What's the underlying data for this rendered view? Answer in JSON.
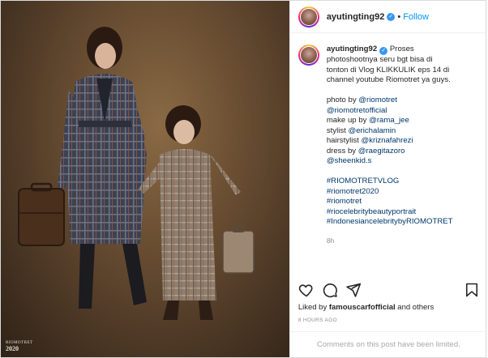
{
  "header": {
    "username": "ayutingting92",
    "separator": "•",
    "follow_label": "Follow",
    "verified_glyph": "✓"
  },
  "caption": {
    "username": "ayutingting92",
    "lines": [
      "Proses",
      "photoshootnya seru bgt bisa di",
      "tonton di Vlog KLIKKULIK eps 14 di",
      "channel youtube Riomotret ya guys."
    ],
    "credits": [
      {
        "prefix": "photo by ",
        "mention": "@riomotret"
      },
      {
        "prefix": "",
        "mention": "@riomotretofficial"
      },
      {
        "prefix": "make up by ",
        "mention": "@rama_jee"
      },
      {
        "prefix": "stylist ",
        "mention": "@erichalamin"
      },
      {
        "prefix": "hairstylist ",
        "mention": "@kriznafahrezi"
      },
      {
        "prefix": "dress by ",
        "mention": "@raegitazoro"
      },
      {
        "prefix": "",
        "mention": "@sheenkid.s"
      }
    ],
    "hashtags": [
      "#RIOMOTRETVLOG",
      "#riomotret2020",
      "#riomotret",
      "#riocelebritybeautyportrait",
      "#IndonesiancelebritybyRIOMOTRET"
    ],
    "time": "8h"
  },
  "actions": {
    "like_icon": "heart-icon",
    "comment_icon": "comment-icon",
    "share_icon": "share-icon",
    "save_icon": "bookmark-icon"
  },
  "likes": {
    "prefix": "Liked by ",
    "user": "famouscarfofficial",
    "suffix": " and others"
  },
  "timestamp": "8 HOURS AGO",
  "comments_limited": "Comments on this post have been limited.",
  "photo": {
    "watermark_line1": "RIOMOTRET",
    "watermark_line2": "2020"
  },
  "colors": {
    "accent": "#0095f6",
    "verified": "#3897f0",
    "link": "#00376b",
    "muted": "#8e8e8e"
  }
}
